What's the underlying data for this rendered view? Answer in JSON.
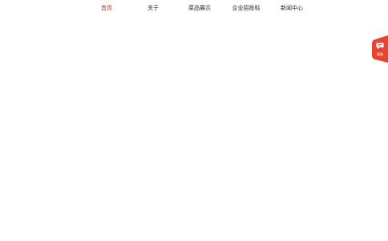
{
  "nav": {
    "items": [
      {
        "label": "首页",
        "active": true
      },
      {
        "label": "关于",
        "active": false
      },
      {
        "label": "菜品展示",
        "active": false
      },
      {
        "label": "企业招投标",
        "active": false
      },
      {
        "label": "新闻中心",
        "active": false
      }
    ]
  },
  "float_service": {
    "label": "客服",
    "icon": "chat-bubble-icon",
    "color": "#e5452f"
  },
  "colors": {
    "active_nav": "#b3322a",
    "nav_text": "#222222",
    "background": "#ffffff"
  }
}
